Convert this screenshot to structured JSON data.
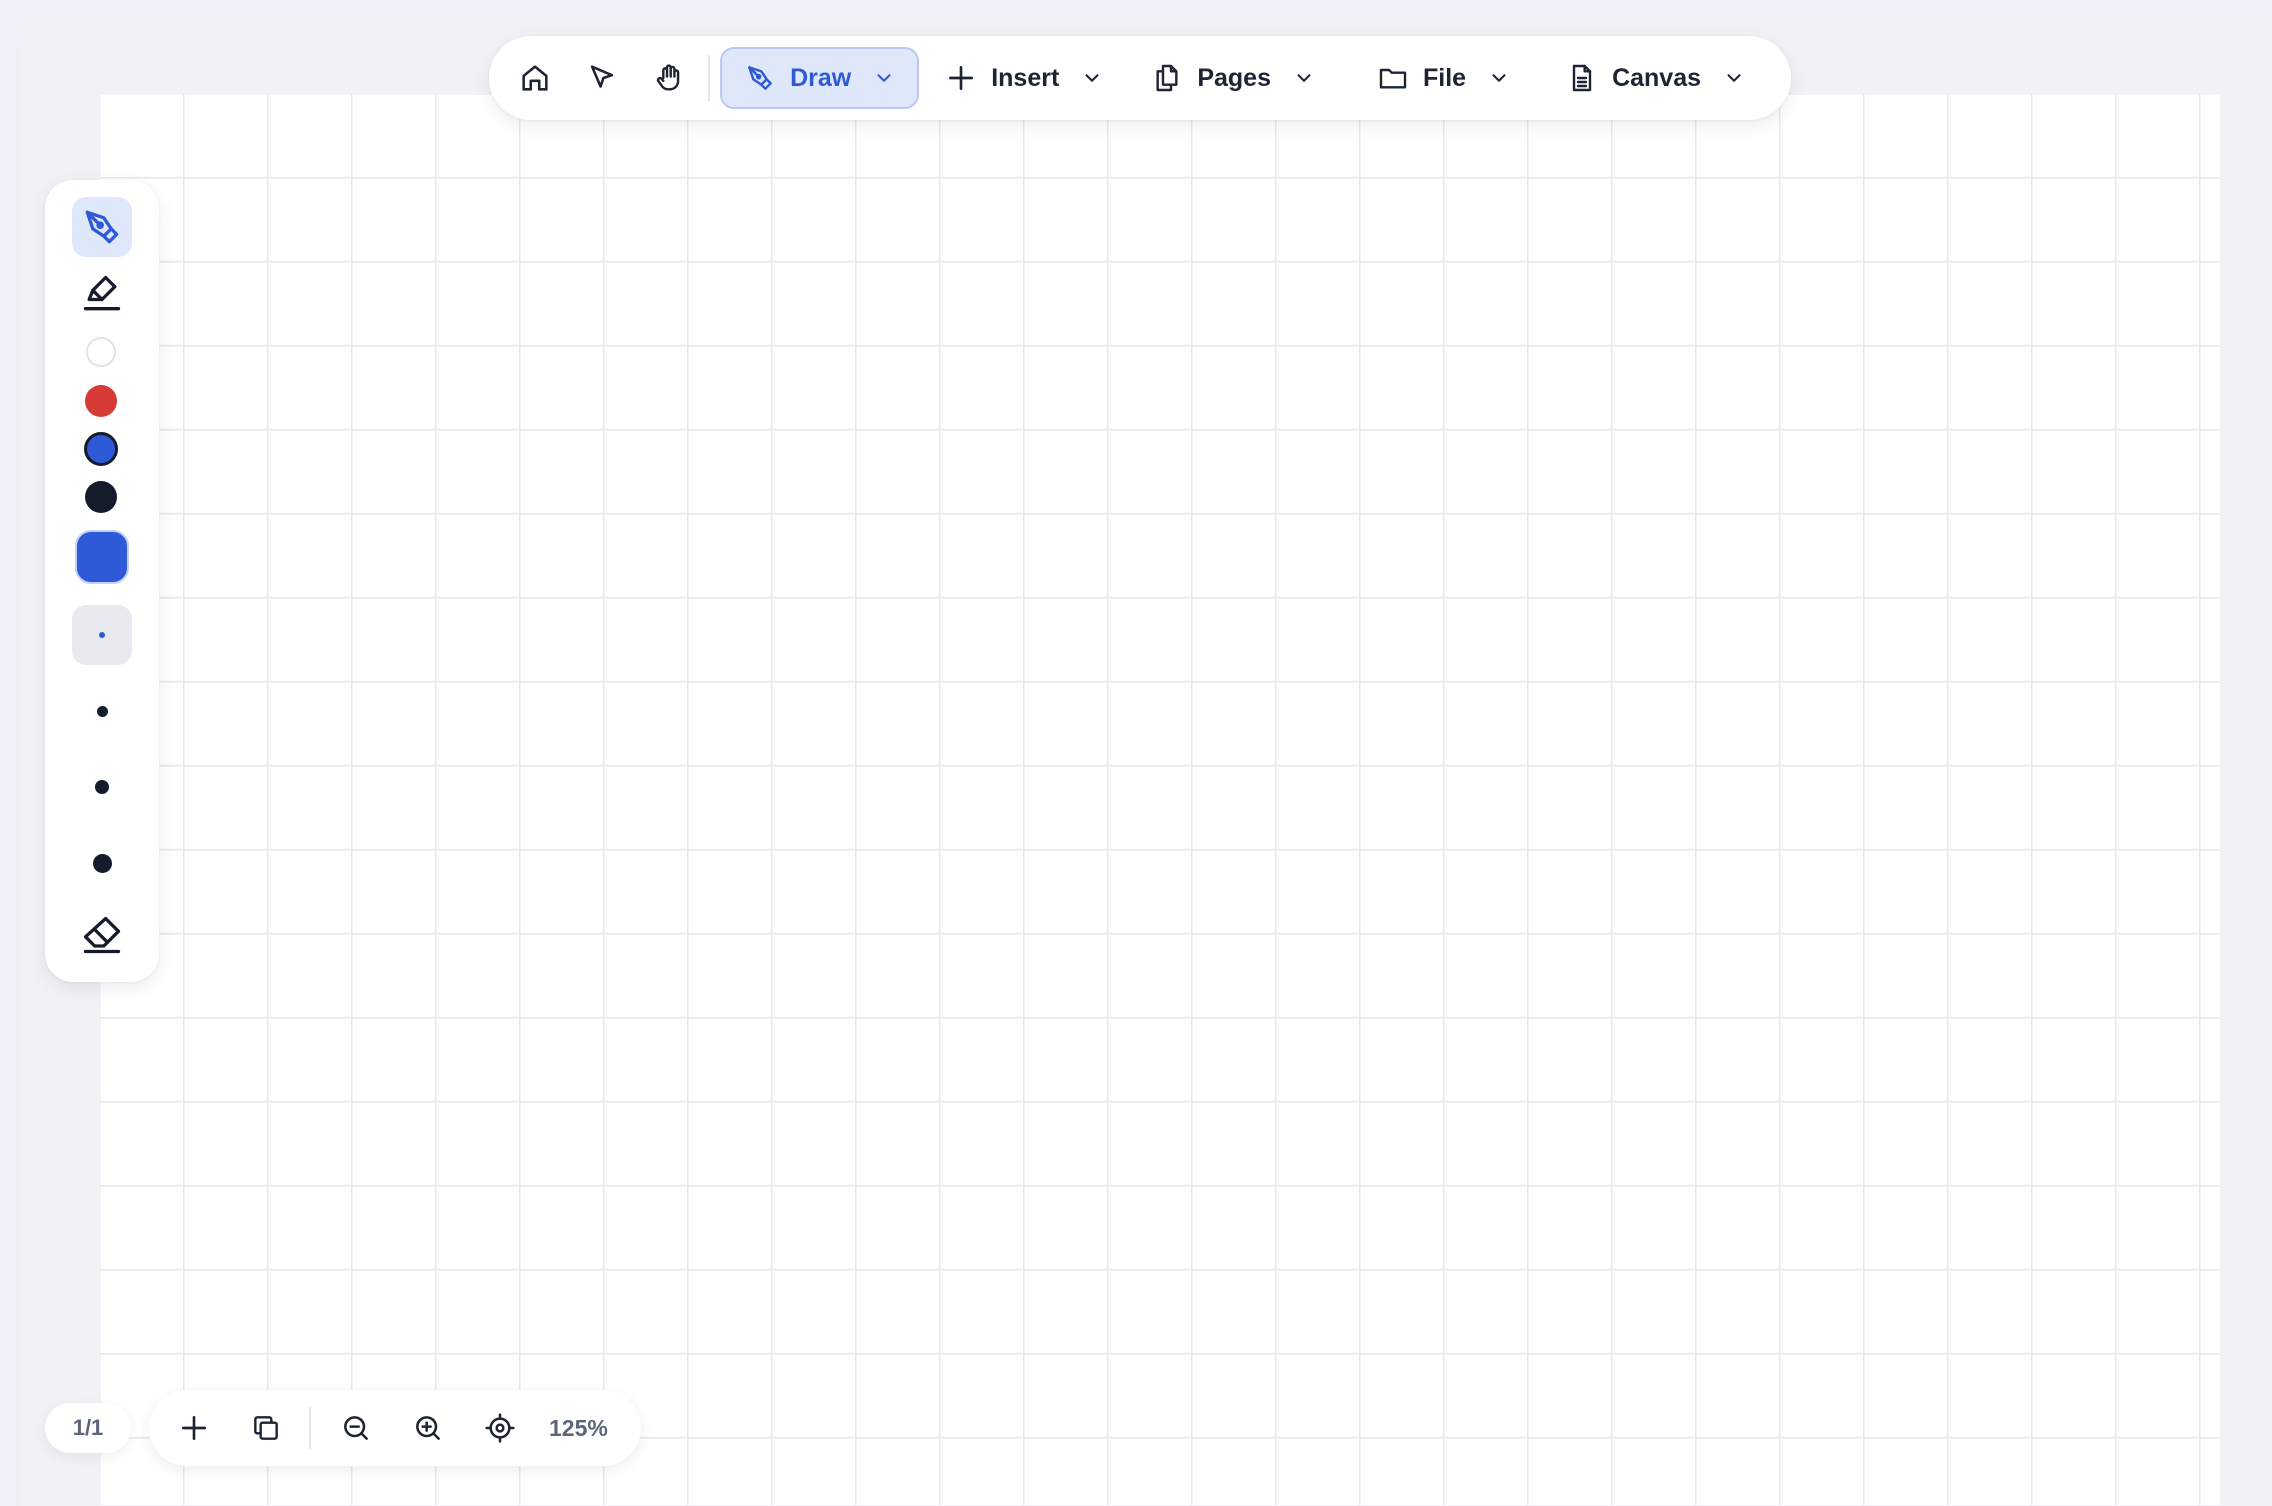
{
  "toolbar": {
    "menus": [
      {
        "label": "Draw",
        "active": true
      },
      {
        "label": "Insert"
      },
      {
        "label": "Pages"
      },
      {
        "label": "File"
      },
      {
        "label": "Canvas"
      }
    ]
  },
  "draw_panel": {
    "tools": [
      "pen-icon",
      "highlighter-icon",
      "eraser-icon"
    ],
    "colors": [
      "#ffffff",
      "#d63b36",
      "#2f5ad7",
      "#141b2b"
    ],
    "selected_color": "#2f5ad7",
    "stroke_sizes": [
      "xs",
      "s",
      "m",
      "l"
    ],
    "selected_stroke_size": "xs"
  },
  "footer": {
    "page_indicator": "1/1",
    "zoom_level": "125%"
  },
  "colors": {
    "accent": "#2f5ad7",
    "accent_bg": "#dfe7fb",
    "text": "#1d2433",
    "muted": "#5b6678"
  }
}
